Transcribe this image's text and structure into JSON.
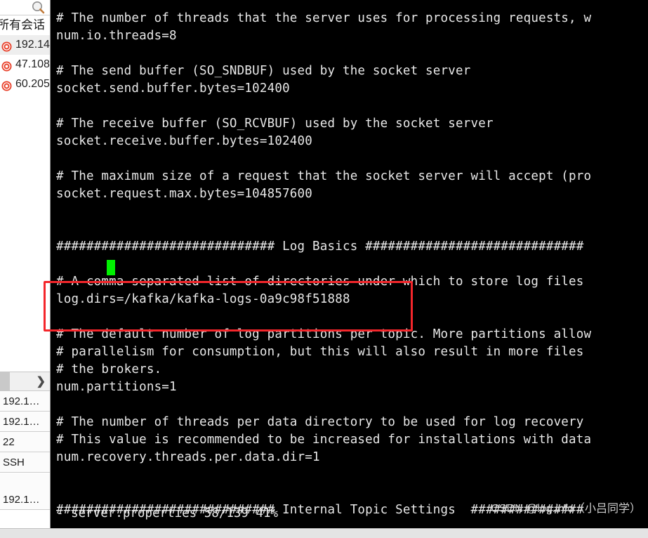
{
  "sidebar": {
    "search_icon": "search-icon",
    "header_label": "所有会话",
    "sessions": [
      {
        "label": "192.14",
        "icon": "session-icon",
        "selected": true
      },
      {
        "label": "47.108",
        "icon": "session-icon",
        "selected": false
      },
      {
        "label": "60.205",
        "icon": "session-icon",
        "selected": false
      }
    ],
    "expand_chevron": "❯",
    "properties": [
      {
        "value": "192.1…"
      },
      {
        "value": "192.1…"
      },
      {
        "value": "22"
      },
      {
        "value": "SSH"
      },
      {
        "value": ""
      },
      {
        "value": "192.1…"
      },
      {
        "value": ""
      }
    ]
  },
  "terminal": {
    "lines": [
      "# The number of threads that the server uses for processing requests, w",
      "num.io.threads=8",
      "",
      "# The send buffer (SO_SNDBUF) used by the socket server",
      "socket.send.buffer.bytes=102400",
      "",
      "# The receive buffer (SO_RCVBUF) used by the socket server",
      "socket.receive.buffer.bytes=102400",
      "",
      "# The maximum size of a request that the socket server will accept (pro",
      "socket.request.max.bytes=104857600",
      "",
      "",
      "############################# Log Basics #############################",
      "",
      "# A comma separated list of directories under which to store log files",
      "log.dirs=/kafka/kafka-logs-0a9c98f51888",
      "",
      "# The default number of log partitions per topic. More partitions allow",
      "# parallelism for consumption, but this will also result in more files ",
      "# the brokers.",
      "num.partitions=1",
      "",
      "# The number of threads per data directory to be used for log recovery ",
      "# This value is recommended to be increased for installations with data",
      "num.recovery.threads.per.data.dir=1",
      "",
      "",
      "############################# Internal Topic Settings  ###############"
    ],
    "cursor": "block-cursor",
    "pager_status": "- server.properties 58/139 41%"
  },
  "annotation": {
    "name": "log-dirs-highlight",
    "color": "#f4262b"
  },
  "watermark": {
    "text": "CSDN @log.info（小吕同学）"
  },
  "colors": {
    "terminal_bg": "#000000",
    "terminal_fg": "#e8e8e8",
    "cursor_green": "#00f000",
    "annotation_red": "#f4262b",
    "sidebar_bg": "#ffffff"
  }
}
